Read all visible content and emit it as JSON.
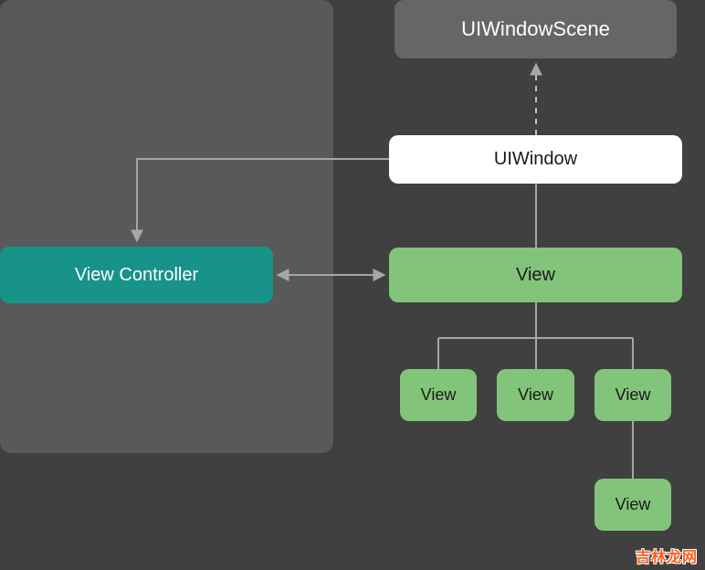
{
  "diagram": {
    "scene_label": "UIWindowScene",
    "window_label": "UIWindow",
    "controller_label": "View Controller",
    "root_view_label": "View",
    "child_view_label": "View",
    "leaf_view_label": "View",
    "watermark": "吉林龙网"
  }
}
